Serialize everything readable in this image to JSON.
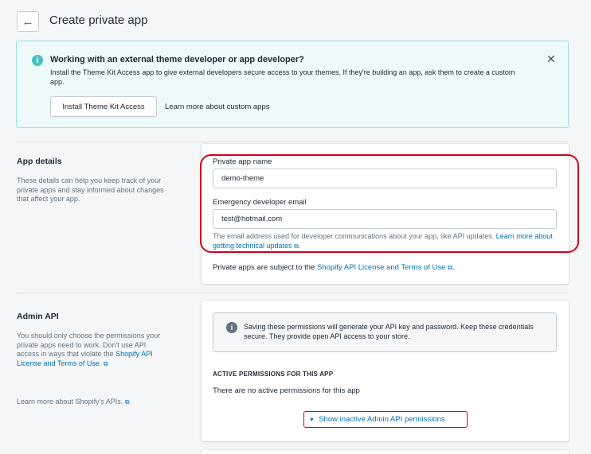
{
  "header": {
    "back_icon": "←",
    "title": "Create private app"
  },
  "banner": {
    "icon": "i",
    "title": "Working with an external theme developer or app developer?",
    "body": "Install the Theme Kit Access app to give external developers secure access to your themes. If they're building an app, ask them to create a custom app.",
    "close_icon": "✕",
    "install_button": "Install Theme Kit Access",
    "learn_link": "Learn more about custom apps"
  },
  "app_details": {
    "title": "App details",
    "description": "These details can help you keep track of your private apps and stay informed about changes that affect your app.",
    "name_label": "Private app name",
    "name_value": "demo-theme",
    "email_label": "Emergency developer email",
    "email_value": "test@hotmail.com",
    "help_prefix": "The email address used for developer communications about your app, like API updates. ",
    "help_link": "Learn more about getting technical updates",
    "terms_prefix": "Private apps are subject to the ",
    "terms_link": "Shopify API License and Terms of Use",
    "terms_suffix": "."
  },
  "admin_api": {
    "title": "Admin API",
    "description_prefix": "You should only choose the permissions your private apps need to work. Don't use API access in ways that violate the ",
    "description_link": "Shopify API License and Terms of Use",
    "description_suffix": ".",
    "learn_link": "Learn more about Shopify's APIs.",
    "callout_icon": "i",
    "callout_text": "Saving these permissions will generate your API key and password. Keep these credentials secure. They provide open API access to your store.",
    "active_heading": "ACTIVE PERMISSIONS FOR THIS APP",
    "no_permissions": "There are no active permissions for this app",
    "show_inactive_icon": "▼",
    "show_inactive": "Show inactive Admin API permissions"
  },
  "external_link_icon": "⧉",
  "colors": {
    "link": "#006fbb",
    "highlight": "#d0021b",
    "banner_bg": "#eef9f9",
    "banner_border": "#9ddfe3",
    "info": "#47c1bf"
  }
}
